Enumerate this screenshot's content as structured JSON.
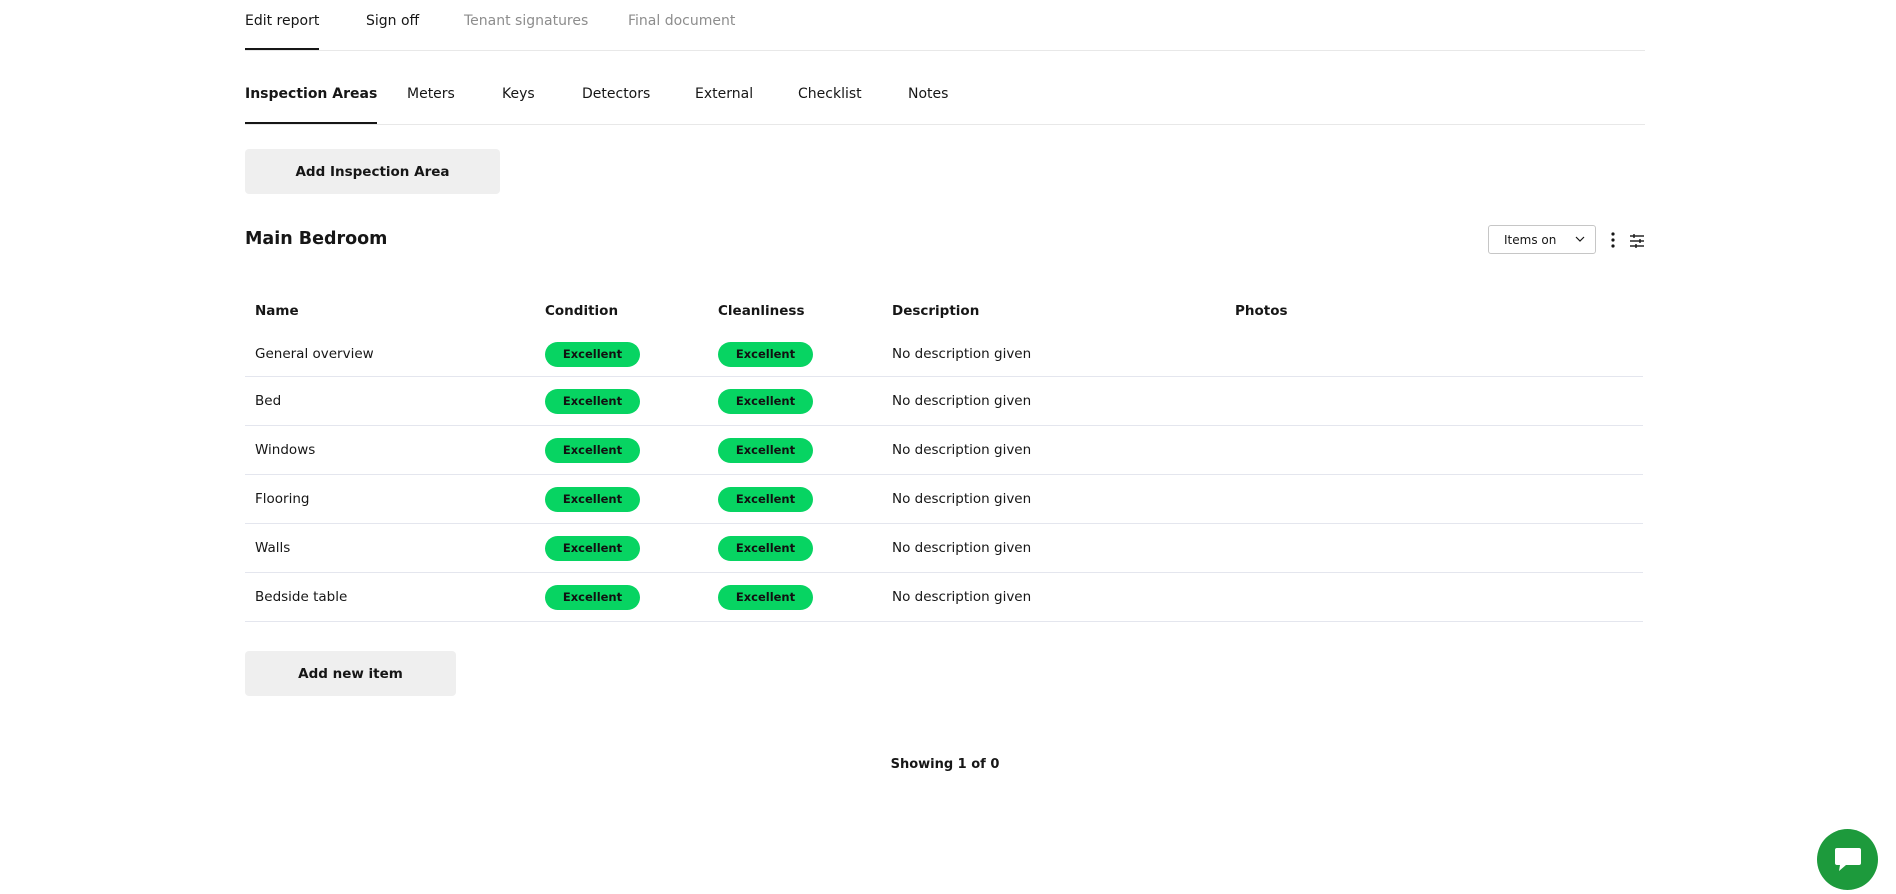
{
  "top_tabs": [
    {
      "label": "Edit report"
    },
    {
      "label": "Sign off"
    },
    {
      "label": "Tenant signatures"
    },
    {
      "label": "Final document"
    }
  ],
  "sub_tabs": [
    {
      "label": "Inspection Areas"
    },
    {
      "label": "Meters"
    },
    {
      "label": "Keys"
    },
    {
      "label": "Detectors"
    },
    {
      "label": "External"
    },
    {
      "label": "Checklist"
    },
    {
      "label": "Notes"
    }
  ],
  "add_area_label": "Add Inspection Area",
  "section": {
    "title": "Main Bedroom",
    "items_select_value": "Items on"
  },
  "table": {
    "headers": {
      "name": "Name",
      "condition": "Condition",
      "cleanliness": "Cleanliness",
      "description": "Description",
      "photos": "Photos"
    },
    "rows": [
      {
        "name": "General overview",
        "condition": "Excellent",
        "cleanliness": "Excellent",
        "description": "No description given"
      },
      {
        "name": "Bed",
        "condition": "Excellent",
        "cleanliness": "Excellent",
        "description": "No description given"
      },
      {
        "name": "Windows",
        "condition": "Excellent",
        "cleanliness": "Excellent",
        "description": "No description given"
      },
      {
        "name": "Flooring",
        "condition": "Excellent",
        "cleanliness": "Excellent",
        "description": "No description given"
      },
      {
        "name": "Walls",
        "condition": "Excellent",
        "cleanliness": "Excellent",
        "description": "No description given"
      },
      {
        "name": "Bedside table",
        "condition": "Excellent",
        "cleanliness": "Excellent",
        "description": "No description given"
      }
    ]
  },
  "add_item_label": "Add new item",
  "pagination_text": "Showing 1 of 0",
  "colors": {
    "pill": "#07d462",
    "chat_button": "#1d9a3c",
    "text": "#161616",
    "muted": "#8d8d8d"
  },
  "icons": {
    "select": "chevron-down-icon",
    "menu": "kebab-menu-icon",
    "filter": "filter-lines-icon",
    "chat": "chat-bubble-icon"
  }
}
